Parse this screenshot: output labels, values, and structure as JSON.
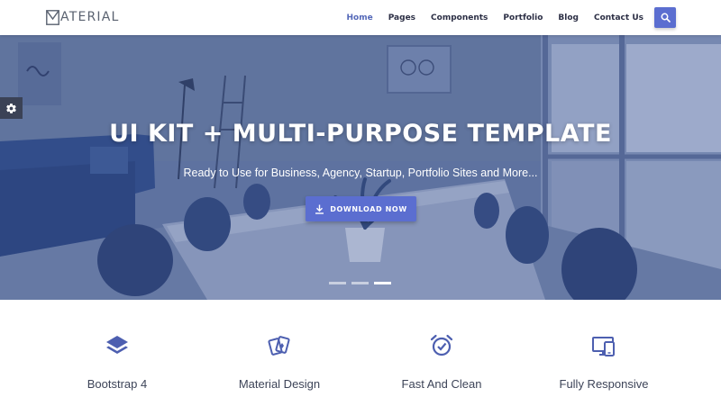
{
  "brand": {
    "logo_text": "ATERIAL"
  },
  "nav": {
    "items": [
      {
        "label": "Home",
        "active": true
      },
      {
        "label": "Pages",
        "active": false
      },
      {
        "label": "Components",
        "active": false
      },
      {
        "label": "Portfolio",
        "active": false
      },
      {
        "label": "Blog",
        "active": false
      },
      {
        "label": "Contact Us",
        "active": false
      }
    ],
    "search_icon": "search-icon"
  },
  "hero": {
    "title": "UI KIT + MULTI-PURPOSE TEMPLATE",
    "subtitle": "Ready to Use for Business, Agency, Startup, Portfolio Sites and More...",
    "cta_label": "DOWNLOAD NOW",
    "cta_icon": "download-icon",
    "slides_total": 3,
    "active_slide": 3
  },
  "settings": {
    "icon": "gear-icon"
  },
  "features": [
    {
      "label": "Bootstrap 4",
      "icon": "layers-icon"
    },
    {
      "label": "Material Design",
      "icon": "cards-icon"
    },
    {
      "label": "Fast And Clean",
      "icon": "alarm-clock-icon"
    },
    {
      "label": "Fully Responsive",
      "icon": "devices-icon"
    }
  ],
  "colors": {
    "accent": "#5b6ed0",
    "nav_active": "#5468b8",
    "nav_text": "#2c2f45",
    "hero_overlay": "#5a6e96",
    "settings_bg": "#3b4256",
    "feature_text": "#3d4458"
  }
}
